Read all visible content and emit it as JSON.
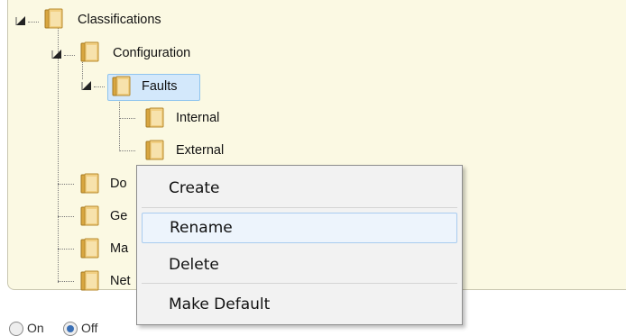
{
  "tree": {
    "root": {
      "label": "Classifications",
      "icon": "folder-icon",
      "expanded": true
    },
    "configuration": {
      "label": "Configuration",
      "icon": "folder-icon",
      "expanded": true
    },
    "faults": {
      "label": "Faults",
      "icon": "folder-icon",
      "expanded": true,
      "selected": true
    },
    "internal": {
      "label": "Internal",
      "icon": "folder-icon"
    },
    "external": {
      "label": "External",
      "icon": "folder-icon"
    },
    "partial_items": [
      {
        "label": "Do"
      },
      {
        "label": "Ge"
      },
      {
        "label": "Ma"
      },
      {
        "label": "Net"
      }
    ]
  },
  "context_menu": {
    "items": [
      {
        "label": "Create"
      },
      {
        "label": "Rename",
        "hovered": true
      },
      {
        "label": "Delete"
      },
      {
        "label": "Make Default"
      }
    ]
  },
  "radio": {
    "on_label": "On",
    "off_label": "Off",
    "selected": "off"
  },
  "colors": {
    "panel_bg": "#fbf9e3",
    "selection_bg": "#d3e8fb",
    "menu_bg": "#f2f2f2",
    "menu_hover": "#edf4fc"
  }
}
